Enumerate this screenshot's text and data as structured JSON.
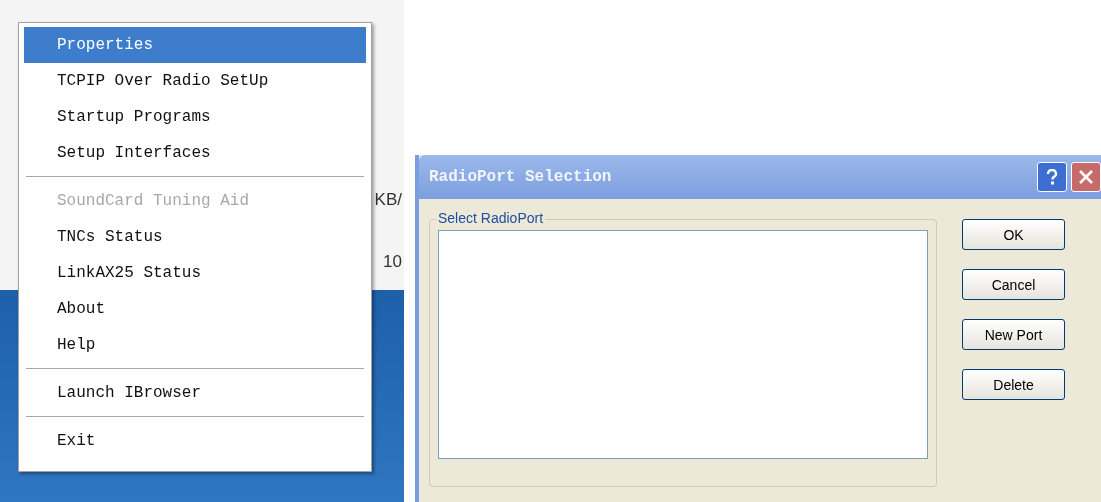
{
  "background": {
    "texts": [
      "KB/",
      "10"
    ]
  },
  "context_menu": {
    "items": [
      {
        "kind": "item",
        "label": "Properties",
        "selected": true,
        "disabled": false
      },
      {
        "kind": "item",
        "label": "TCPIP Over Radio SetUp",
        "selected": false,
        "disabled": false
      },
      {
        "kind": "item",
        "label": "Startup Programs",
        "selected": false,
        "disabled": false
      },
      {
        "kind": "item",
        "label": "Setup Interfaces",
        "selected": false,
        "disabled": false
      },
      {
        "kind": "separator"
      },
      {
        "kind": "item",
        "label": "SoundCard Tuning Aid",
        "selected": false,
        "disabled": true
      },
      {
        "kind": "item",
        "label": "TNCs Status",
        "selected": false,
        "disabled": false
      },
      {
        "kind": "item",
        "label": "LinkAX25 Status",
        "selected": false,
        "disabled": false
      },
      {
        "kind": "item",
        "label": "About",
        "selected": false,
        "disabled": false
      },
      {
        "kind": "item",
        "label": "Help",
        "selected": false,
        "disabled": false
      },
      {
        "kind": "separator"
      },
      {
        "kind": "item",
        "label": "Launch IBrowser",
        "selected": false,
        "disabled": false
      },
      {
        "kind": "separator"
      },
      {
        "kind": "item",
        "label": "Exit",
        "selected": false,
        "disabled": false
      }
    ]
  },
  "dialog": {
    "title": "RadioPort Selection",
    "group_label": "Select RadioPort",
    "buttons": [
      "OK",
      "Cancel",
      "New Port",
      "Delete"
    ]
  }
}
